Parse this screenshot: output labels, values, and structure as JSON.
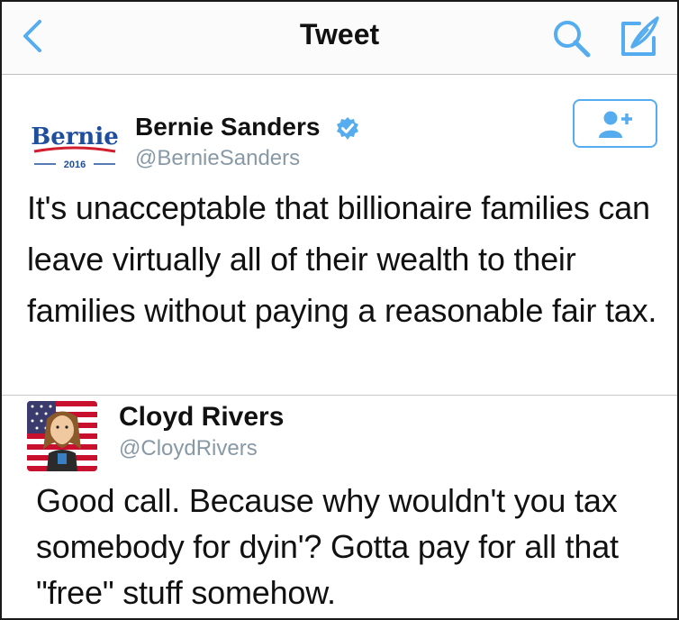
{
  "navbar": {
    "title": "Tweet",
    "back_icon": "chevron-left-icon",
    "search_icon": "search-icon",
    "compose_icon": "compose-icon"
  },
  "tweet": {
    "author_name": "Bernie Sanders",
    "author_handle": "@BernieSanders",
    "avatar_logo_text": "Bernie",
    "avatar_logo_year": "2016",
    "verified": true,
    "follow_icon": "add-user-icon",
    "text": "It's unacceptable that billionaire families can leave virtually all of their wealth to their families without paying a reasonable fair tax."
  },
  "reply": {
    "author_name": "Cloyd Rivers",
    "author_handle": "@CloydRivers",
    "text": "Good call. Because why wouldn't you tax somebody for dyin'? Gotta pay for all that \"free\" stuff somehow."
  },
  "colors": {
    "accent": "#55acee",
    "handle": "#8899a6",
    "bernie_blue": "#1f4e9c",
    "bernie_red": "#d11f2e"
  }
}
